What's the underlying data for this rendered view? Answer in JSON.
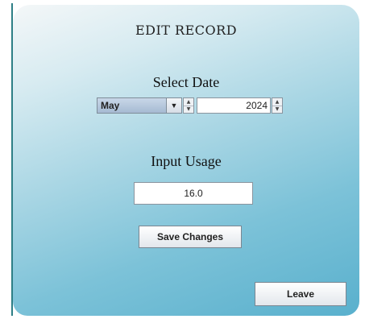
{
  "window": {
    "title": "EDIT RECORD"
  },
  "date_section": {
    "label": "Select Date",
    "month_value": "May",
    "year_value": "2024"
  },
  "usage_section": {
    "label": "Input Usage",
    "value": "16.0"
  },
  "buttons": {
    "save_label": "Save Changes",
    "leave_label": "Leave"
  }
}
